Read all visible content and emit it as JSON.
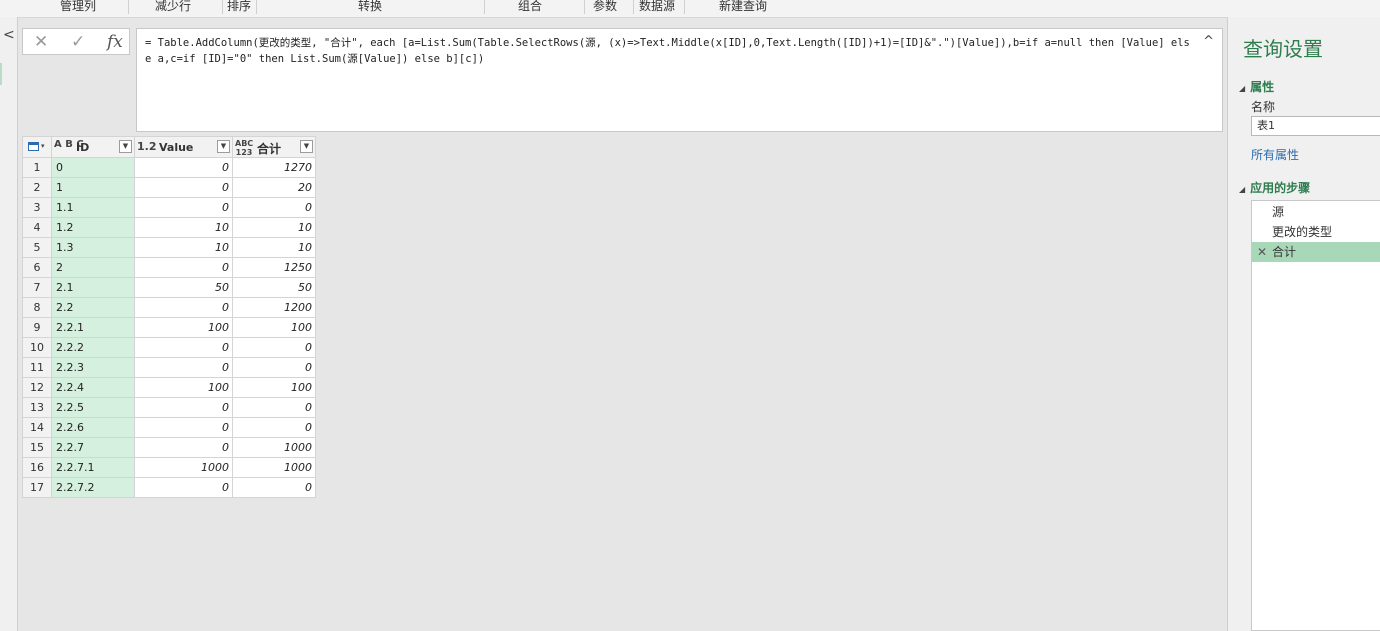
{
  "ribbon": {
    "groups": [
      "管理列",
      "减少行",
      "排序",
      "转换",
      "组合",
      "参数",
      "数据源",
      "新建查询"
    ]
  },
  "nav": {
    "collapse_icon": "chevron-left-icon"
  },
  "formula_bar": {
    "cancel_icon": "✕",
    "confirm_icon": "✓",
    "fx_label": "fx",
    "formula": "= Table.AddColumn(更改的类型, \"合计\", each [a=List.Sum(Table.SelectRows(源, (x)=>Text.Middle(x[ID],0,Text.Length([ID])+1)=[ID]&\".\")[Value]),b=if a=null then [Value] else a,c=if [ID]=\"0\" then List.Sum(源[Value]) else b][c])"
  },
  "grid": {
    "columns": [
      {
        "type_label": "A B C",
        "name": "ID"
      },
      {
        "type_label": "1.2",
        "name": "Value"
      },
      {
        "type_label": "ABC 123",
        "name": "合计"
      }
    ],
    "rows": [
      {
        "n": "1",
        "id": "0",
        "value": "0",
        "total": "1270"
      },
      {
        "n": "2",
        "id": "1",
        "value": "0",
        "total": "20"
      },
      {
        "n": "3",
        "id": "1.1",
        "value": "0",
        "total": "0"
      },
      {
        "n": "4",
        "id": "1.2",
        "value": "10",
        "total": "10"
      },
      {
        "n": "5",
        "id": "1.3",
        "value": "10",
        "total": "10"
      },
      {
        "n": "6",
        "id": "2",
        "value": "0",
        "total": "1250"
      },
      {
        "n": "7",
        "id": "2.1",
        "value": "50",
        "total": "50"
      },
      {
        "n": "8",
        "id": "2.2",
        "value": "0",
        "total": "1200"
      },
      {
        "n": "9",
        "id": "2.2.1",
        "value": "100",
        "total": "100"
      },
      {
        "n": "10",
        "id": "2.2.2",
        "value": "0",
        "total": "0"
      },
      {
        "n": "11",
        "id": "2.2.3",
        "value": "0",
        "total": "0"
      },
      {
        "n": "12",
        "id": "2.2.4",
        "value": "100",
        "total": "100"
      },
      {
        "n": "13",
        "id": "2.2.5",
        "value": "0",
        "total": "0"
      },
      {
        "n": "14",
        "id": "2.2.6",
        "value": "0",
        "total": "0"
      },
      {
        "n": "15",
        "id": "2.2.7",
        "value": "0",
        "total": "1000"
      },
      {
        "n": "16",
        "id": "2.2.7.1",
        "value": "1000",
        "total": "1000"
      },
      {
        "n": "17",
        "id": "2.2.7.2",
        "value": "0",
        "total": "0"
      }
    ]
  },
  "settings": {
    "title": "查询设置",
    "properties_header": "属性",
    "name_label": "名称",
    "name_value": "表1",
    "all_properties_link": "所有属性",
    "steps_header": "应用的步骤",
    "steps": [
      {
        "label": "源",
        "active": false
      },
      {
        "label": "更改的类型",
        "active": false
      },
      {
        "label": "合计",
        "active": true
      }
    ],
    "active_color": "#a8d8b8",
    "accent_color": "#2e7d4f"
  }
}
